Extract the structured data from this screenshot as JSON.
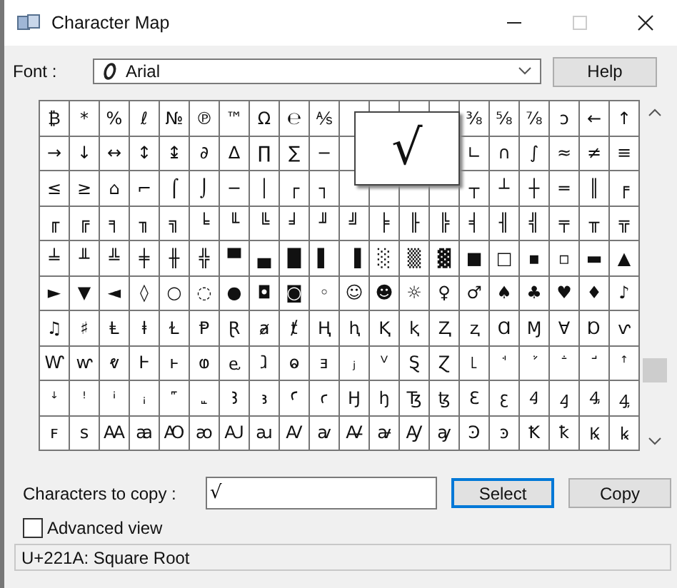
{
  "window": {
    "title": "Character Map"
  },
  "font": {
    "label": "Font :",
    "value": "Arial"
  },
  "help_button": "Help",
  "grid": {
    "rows": [
      [
        "₿",
        "*",
        "%",
        "ℓ",
        "№",
        "℗",
        "™",
        "Ω",
        "℮",
        "⅍",
        null,
        null,
        null,
        null,
        "⅜",
        "⅝",
        "⅞",
        "ↄ",
        "←",
        "↑"
      ],
      [
        "→",
        "↓",
        "↔",
        "↕",
        "↨",
        "∂",
        "∆",
        "∏",
        "∑",
        "−",
        null,
        null,
        null,
        null,
        "∟",
        "∩",
        "∫",
        "≈",
        "≠",
        "≡"
      ],
      [
        "≤",
        "≥",
        "⌂",
        "⌐",
        "⌠",
        "⌡",
        "─",
        "│",
        "┌",
        "┐",
        null,
        null,
        null,
        null,
        "┬",
        "┴",
        "┼",
        "═",
        "║",
        "╒"
      ],
      [
        "╓",
        "╔",
        "╕",
        "╖",
        "╗",
        "╘",
        "╙",
        "╚",
        "╛",
        "╜",
        "╝",
        "╞",
        "╟",
        "╠",
        "╡",
        "╢",
        "╣",
        "╤",
        "╥",
        "╦"
      ],
      [
        "╧",
        "╨",
        "╩",
        "╪",
        "╫",
        "╬",
        "▀",
        "▄",
        "█",
        "▌",
        "▐",
        "░",
        "▒",
        "▓",
        "■",
        "□",
        "▪",
        "▫",
        "▬",
        "▲"
      ],
      [
        "►",
        "▼",
        "◄",
        "◊",
        "○",
        "◌",
        "●",
        "◘",
        "◙",
        "◦",
        "☺",
        "☻",
        "☼",
        "♀",
        "♂",
        "♠",
        "♣",
        "♥",
        "♦",
        "♪"
      ],
      [
        "♫",
        "♯",
        "Ⱡ",
        "ⱡ",
        "Ɫ",
        "Ᵽ",
        "Ɽ",
        "ⱥ",
        "ⱦ",
        "Ⱨ",
        "ⱨ",
        "Ⱪ",
        "ⱪ",
        "Ⱬ",
        "ⱬ",
        "Ɑ",
        "Ɱ",
        "Ɐ",
        "Ɒ",
        "ⱱ"
      ],
      [
        "Ⱳ",
        "ⱳ",
        "ⱴ",
        "Ⱶ",
        "ⱶ",
        "ⱷ",
        "ⱸ",
        "ⱹ",
        "ⱺ",
        "ⱻ",
        "ⱼ",
        "ⱽ",
        "Ȿ",
        "Ɀ",
        "꜖",
        "ꜗ",
        "ꜘ",
        "ꜙ",
        "ꜚ",
        "ꜛ"
      ],
      [
        "ꜜ",
        "ꜝ",
        "ꜞ",
        "ꜟ",
        "꜠",
        "꜡",
        "Ꜣ",
        "ꜣ",
        "Ꜥ",
        "ꜥ",
        "Ꜧ",
        "ꜧ",
        "Ꜩ",
        "ꜩ",
        "Ꜫ",
        "ꜫ",
        "Ꜭ",
        "ꜭ",
        "Ꜯ",
        "ꜯ"
      ],
      [
        "ꜰ",
        "ꜱ",
        "Ꜳ",
        "ꜳ",
        "Ꜵ",
        "ꜵ",
        "Ꜷ",
        "ꜷ",
        "Ꜹ",
        "ꜹ",
        "Ꜻ",
        "ꜻ",
        "Ꜽ",
        "ꜽ",
        "Ꜿ",
        "ꜿ",
        "Ꝁ",
        "ꝁ",
        "Ꝃ",
        "ꝃ"
      ]
    ]
  },
  "magnifier": {
    "char": "√"
  },
  "copy": {
    "label": "Characters to copy :",
    "value": "√"
  },
  "buttons": [
    {
      "label": "Select",
      "focused": true
    },
    {
      "label": "Copy",
      "focused": false
    }
  ],
  "advanced_view": {
    "label": "Advanced view",
    "checked": false
  },
  "status_bar": "U+221A: Square Root"
}
